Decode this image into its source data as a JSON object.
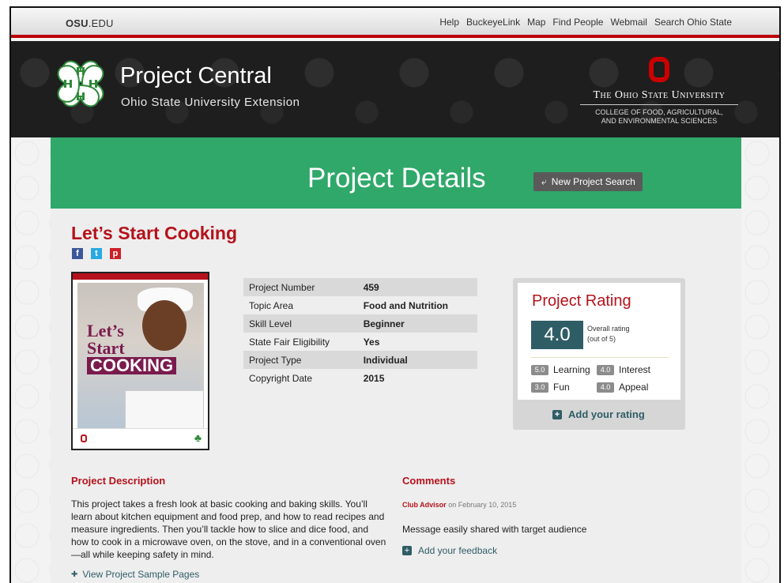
{
  "topbar": {
    "logo_bold": "OSU",
    "logo_rest": ".EDU",
    "links": [
      "Help",
      "BuckeyeLink",
      "Map",
      "Find People",
      "Webmail",
      "Search Ohio State"
    ]
  },
  "header": {
    "title": "Project Central",
    "subtitle": "Ohio State University Extension",
    "osu_name": "The Ohio State University",
    "college_line1": "COLLEGE OF FOOD, AGRICULTURAL,",
    "college_line2": "AND ENVIRONMENTAL SCIENCES"
  },
  "banner": {
    "title": "Project Details",
    "new_search_label": "New Project Search"
  },
  "project": {
    "title": "Let’s Start Cooking",
    "cover_line1": "Let’s",
    "cover_line2": "Start",
    "cover_line3": "COOKING",
    "details": [
      {
        "label": "Project Number",
        "value": "459"
      },
      {
        "label": "Topic Area",
        "value": "Food and Nutrition"
      },
      {
        "label": "Skill Level",
        "value": "Beginner"
      },
      {
        "label": "State Fair Eligibility",
        "value": "Yes"
      },
      {
        "label": "Project Type",
        "value": "Individual"
      },
      {
        "label": "Copyright Date",
        "value": "2015"
      }
    ]
  },
  "rating": {
    "title": "Project Rating",
    "overall": "4.0",
    "overall_note_1": "Overall rating",
    "overall_note_2": "(out of 5)",
    "learning_score": "5.0",
    "learning_label": "Learning",
    "interest_score": "4.0",
    "interest_label": "Interest",
    "fun_score": "3.0",
    "fun_label": "Fun",
    "appeal_score": "4.0",
    "appeal_label": "Appeal",
    "add_label": "Add your rating"
  },
  "description": {
    "heading": "Project Description",
    "text": "This project takes a fresh look at basic cooking and baking skills. You’ll learn about kitchen equipment and food prep, and how to read recipes and measure ingredients. Then you’ll tackle how to slice and dice food, and how to cook in a microwave oven, on the stove, and in a conventional oven—all while keeping safety in mind.",
    "sample_link": "View Project Sample Pages"
  },
  "comments": {
    "heading": "Comments",
    "author": "Club Advisor",
    "date": "on February 10, 2015",
    "text": "Message easily shared with target audience",
    "feedback_label": "Add your feedback"
  },
  "colors": {
    "accent_red": "#b5121b",
    "banner_green": "#2fa86a",
    "score_teal": "#2f5d66"
  }
}
